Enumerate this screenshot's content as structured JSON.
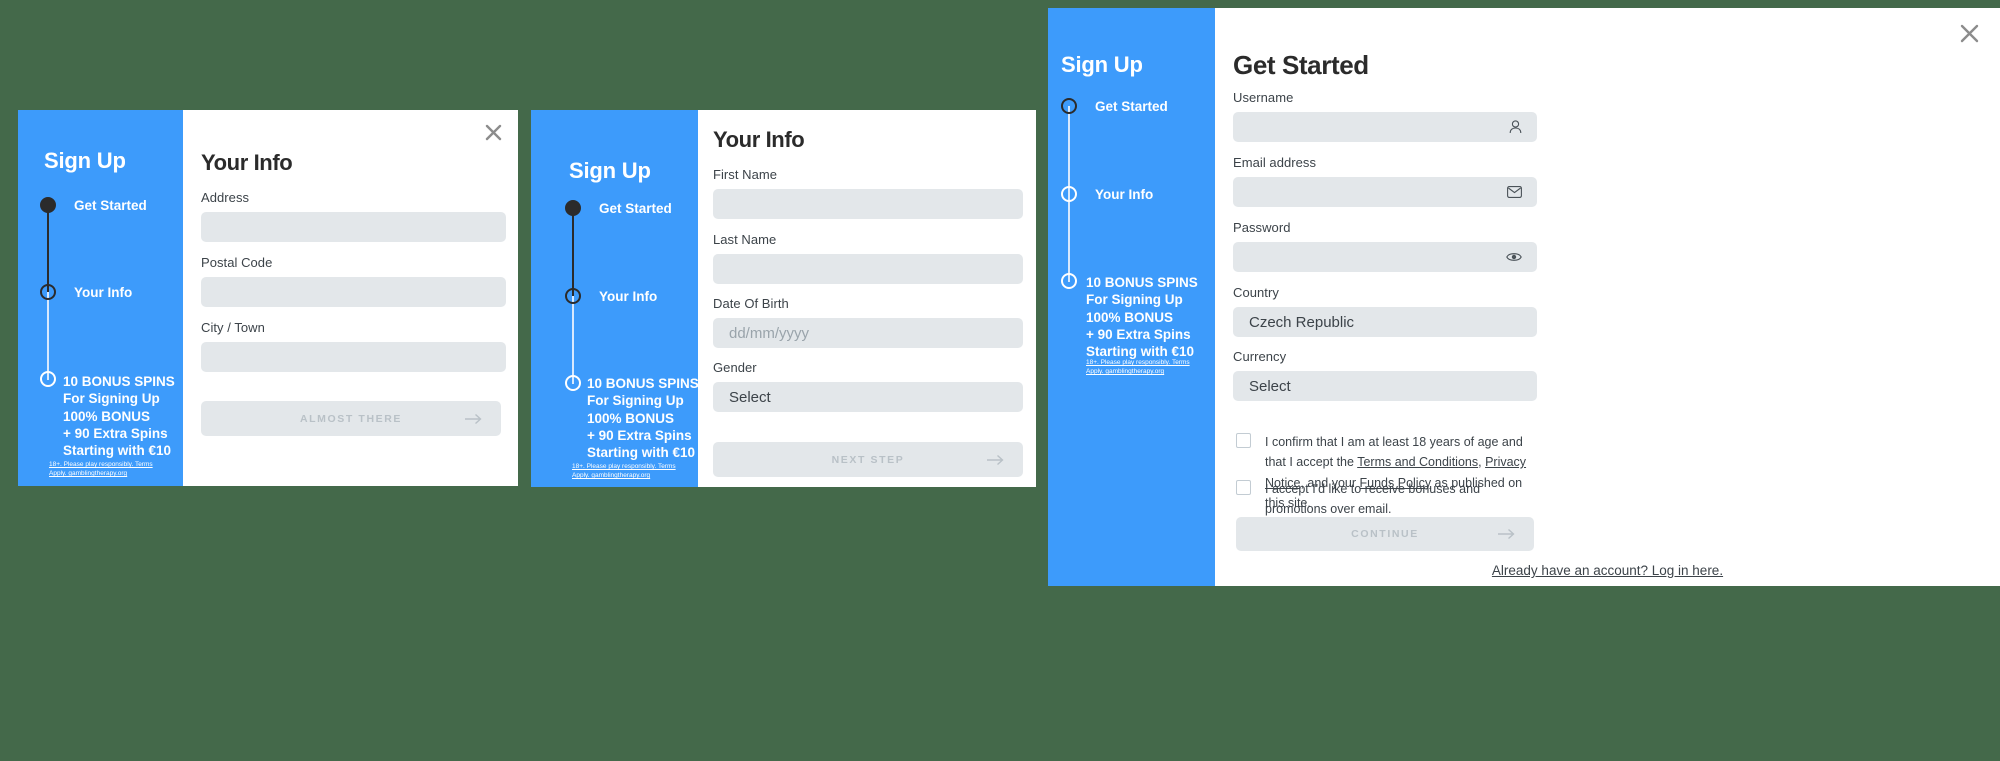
{
  "theme": {
    "background": "#44694a",
    "brand_blue": "#3d9bfb",
    "input_grey": "#e3e7ea",
    "dark": "#2b2b2b",
    "muted_text": "#b9c1c7"
  },
  "shared": {
    "sidebar_title": "Sign Up",
    "steps": [
      {
        "label": "Get Started"
      },
      {
        "label": "Your Info"
      }
    ],
    "bonus_lines": [
      "10 BONUS SPINS",
      "For Signing Up",
      "100% BONUS",
      "+ 90 Extra Spins",
      "Starting with €10"
    ],
    "legal": "18+. Please play responsibly. Terms Apply. gamblingtherapy.org",
    "select_placeholder": "Select"
  },
  "modal1": {
    "title": "Your Info",
    "close_icon": "close-icon",
    "fields": [
      {
        "label": "Address",
        "value": "",
        "placeholder": ""
      },
      {
        "label": "Postal Code",
        "value": "",
        "placeholder": ""
      },
      {
        "label": "City / Town",
        "value": "",
        "placeholder": ""
      }
    ],
    "cta_label": "ALMOST THERE",
    "cta_icon": "arrow-right-icon"
  },
  "modal2": {
    "title": "Your Info",
    "fields": [
      {
        "label": "First Name",
        "value": "",
        "placeholder": ""
      },
      {
        "label": "Last Name",
        "value": "",
        "placeholder": ""
      },
      {
        "label": "Date Of Birth",
        "value": "",
        "placeholder": "dd/mm/yyyy"
      }
    ],
    "gender_label": "Gender",
    "gender_value": "Select",
    "cta_label": "NEXT STEP",
    "cta_icon": "arrow-right-icon"
  },
  "modal3": {
    "title": "Get Started",
    "close_icon": "close-icon",
    "username_label": "Username",
    "username_value": "",
    "username_icon": "user-icon",
    "email_label": "Email address",
    "email_value": "",
    "email_icon": "envelope-icon",
    "password_label": "Password",
    "password_value": "",
    "password_icon": "eye-icon",
    "country_label": "Country",
    "country_value": "Czech Republic",
    "currency_label": "Currency",
    "currency_value": "Select",
    "consent_age": {
      "part1": "I confirm that I am at least 18 years of age and that I accept the ",
      "link1": "Terms and Conditions",
      "part2": ", ",
      "link2": "Privacy Notice",
      "part3": ", and your ",
      "link3": "Funds Policy",
      "part4": " as published on this site."
    },
    "consent_marketing": "I accept I'd like to receive bonuses and promotions over email.",
    "cta_label": "CONTINUE",
    "cta_icon": "arrow-right-icon",
    "login_link": "Already have an account? Log in here."
  }
}
